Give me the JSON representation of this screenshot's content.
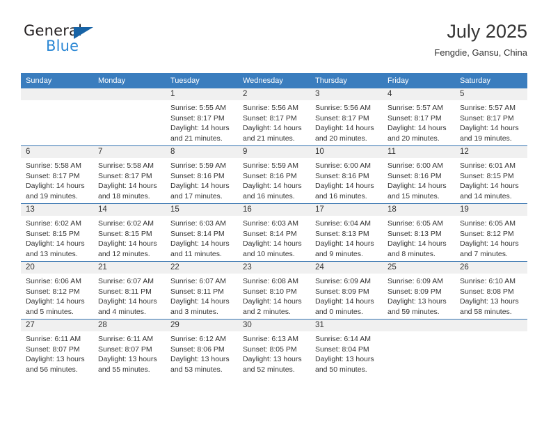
{
  "brand": {
    "name_top": "General",
    "name_bottom": "Blue",
    "triangle_color": "#1763a6",
    "blue_color": "#2b87d4"
  },
  "header": {
    "title": "July 2025",
    "subtitle": "Fengdie, Gansu, China"
  },
  "theme": {
    "header_bg": "#3a7dbe",
    "week_divider": "#2f6fad",
    "daynum_bg": "#f0f0f0",
    "text": "#333333"
  },
  "weekdays": [
    "Sunday",
    "Monday",
    "Tuesday",
    "Wednesday",
    "Thursday",
    "Friday",
    "Saturday"
  ],
  "labels": {
    "sunrise_prefix": "Sunrise:",
    "sunset_prefix": "Sunset:",
    "daylight_prefix": "Daylight:"
  },
  "weeks": [
    [
      {
        "day": "",
        "sunrise": "",
        "sunset": "",
        "daylight": ""
      },
      {
        "day": "",
        "sunrise": "",
        "sunset": "",
        "daylight": ""
      },
      {
        "day": "1",
        "sunrise": "Sunrise: 5:55 AM",
        "sunset": "Sunset: 8:17 PM",
        "daylight": "Daylight: 14 hours and 21 minutes."
      },
      {
        "day": "2",
        "sunrise": "Sunrise: 5:56 AM",
        "sunset": "Sunset: 8:17 PM",
        "daylight": "Daylight: 14 hours and 21 minutes."
      },
      {
        "day": "3",
        "sunrise": "Sunrise: 5:56 AM",
        "sunset": "Sunset: 8:17 PM",
        "daylight": "Daylight: 14 hours and 20 minutes."
      },
      {
        "day": "4",
        "sunrise": "Sunrise: 5:57 AM",
        "sunset": "Sunset: 8:17 PM",
        "daylight": "Daylight: 14 hours and 20 minutes."
      },
      {
        "day": "5",
        "sunrise": "Sunrise: 5:57 AM",
        "sunset": "Sunset: 8:17 PM",
        "daylight": "Daylight: 14 hours and 19 minutes."
      }
    ],
    [
      {
        "day": "6",
        "sunrise": "Sunrise: 5:58 AM",
        "sunset": "Sunset: 8:17 PM",
        "daylight": "Daylight: 14 hours and 19 minutes."
      },
      {
        "day": "7",
        "sunrise": "Sunrise: 5:58 AM",
        "sunset": "Sunset: 8:17 PM",
        "daylight": "Daylight: 14 hours and 18 minutes."
      },
      {
        "day": "8",
        "sunrise": "Sunrise: 5:59 AM",
        "sunset": "Sunset: 8:16 PM",
        "daylight": "Daylight: 14 hours and 17 minutes."
      },
      {
        "day": "9",
        "sunrise": "Sunrise: 5:59 AM",
        "sunset": "Sunset: 8:16 PM",
        "daylight": "Daylight: 14 hours and 16 minutes."
      },
      {
        "day": "10",
        "sunrise": "Sunrise: 6:00 AM",
        "sunset": "Sunset: 8:16 PM",
        "daylight": "Daylight: 14 hours and 16 minutes."
      },
      {
        "day": "11",
        "sunrise": "Sunrise: 6:00 AM",
        "sunset": "Sunset: 8:16 PM",
        "daylight": "Daylight: 14 hours and 15 minutes."
      },
      {
        "day": "12",
        "sunrise": "Sunrise: 6:01 AM",
        "sunset": "Sunset: 8:15 PM",
        "daylight": "Daylight: 14 hours and 14 minutes."
      }
    ],
    [
      {
        "day": "13",
        "sunrise": "Sunrise: 6:02 AM",
        "sunset": "Sunset: 8:15 PM",
        "daylight": "Daylight: 14 hours and 13 minutes."
      },
      {
        "day": "14",
        "sunrise": "Sunrise: 6:02 AM",
        "sunset": "Sunset: 8:15 PM",
        "daylight": "Daylight: 14 hours and 12 minutes."
      },
      {
        "day": "15",
        "sunrise": "Sunrise: 6:03 AM",
        "sunset": "Sunset: 8:14 PM",
        "daylight": "Daylight: 14 hours and 11 minutes."
      },
      {
        "day": "16",
        "sunrise": "Sunrise: 6:03 AM",
        "sunset": "Sunset: 8:14 PM",
        "daylight": "Daylight: 14 hours and 10 minutes."
      },
      {
        "day": "17",
        "sunrise": "Sunrise: 6:04 AM",
        "sunset": "Sunset: 8:13 PM",
        "daylight": "Daylight: 14 hours and 9 minutes."
      },
      {
        "day": "18",
        "sunrise": "Sunrise: 6:05 AM",
        "sunset": "Sunset: 8:13 PM",
        "daylight": "Daylight: 14 hours and 8 minutes."
      },
      {
        "day": "19",
        "sunrise": "Sunrise: 6:05 AM",
        "sunset": "Sunset: 8:12 PM",
        "daylight": "Daylight: 14 hours and 7 minutes."
      }
    ],
    [
      {
        "day": "20",
        "sunrise": "Sunrise: 6:06 AM",
        "sunset": "Sunset: 8:12 PM",
        "daylight": "Daylight: 14 hours and 5 minutes."
      },
      {
        "day": "21",
        "sunrise": "Sunrise: 6:07 AM",
        "sunset": "Sunset: 8:11 PM",
        "daylight": "Daylight: 14 hours and 4 minutes."
      },
      {
        "day": "22",
        "sunrise": "Sunrise: 6:07 AM",
        "sunset": "Sunset: 8:11 PM",
        "daylight": "Daylight: 14 hours and 3 minutes."
      },
      {
        "day": "23",
        "sunrise": "Sunrise: 6:08 AM",
        "sunset": "Sunset: 8:10 PM",
        "daylight": "Daylight: 14 hours and 2 minutes."
      },
      {
        "day": "24",
        "sunrise": "Sunrise: 6:09 AM",
        "sunset": "Sunset: 8:09 PM",
        "daylight": "Daylight: 14 hours and 0 minutes."
      },
      {
        "day": "25",
        "sunrise": "Sunrise: 6:09 AM",
        "sunset": "Sunset: 8:09 PM",
        "daylight": "Daylight: 13 hours and 59 minutes."
      },
      {
        "day": "26",
        "sunrise": "Sunrise: 6:10 AM",
        "sunset": "Sunset: 8:08 PM",
        "daylight": "Daylight: 13 hours and 58 minutes."
      }
    ],
    [
      {
        "day": "27",
        "sunrise": "Sunrise: 6:11 AM",
        "sunset": "Sunset: 8:07 PM",
        "daylight": "Daylight: 13 hours and 56 minutes."
      },
      {
        "day": "28",
        "sunrise": "Sunrise: 6:11 AM",
        "sunset": "Sunset: 8:07 PM",
        "daylight": "Daylight: 13 hours and 55 minutes."
      },
      {
        "day": "29",
        "sunrise": "Sunrise: 6:12 AM",
        "sunset": "Sunset: 8:06 PM",
        "daylight": "Daylight: 13 hours and 53 minutes."
      },
      {
        "day": "30",
        "sunrise": "Sunrise: 6:13 AM",
        "sunset": "Sunset: 8:05 PM",
        "daylight": "Daylight: 13 hours and 52 minutes."
      },
      {
        "day": "31",
        "sunrise": "Sunrise: 6:14 AM",
        "sunset": "Sunset: 8:04 PM",
        "daylight": "Daylight: 13 hours and 50 minutes."
      },
      {
        "day": "",
        "sunrise": "",
        "sunset": "",
        "daylight": ""
      },
      {
        "day": "",
        "sunrise": "",
        "sunset": "",
        "daylight": ""
      }
    ]
  ]
}
